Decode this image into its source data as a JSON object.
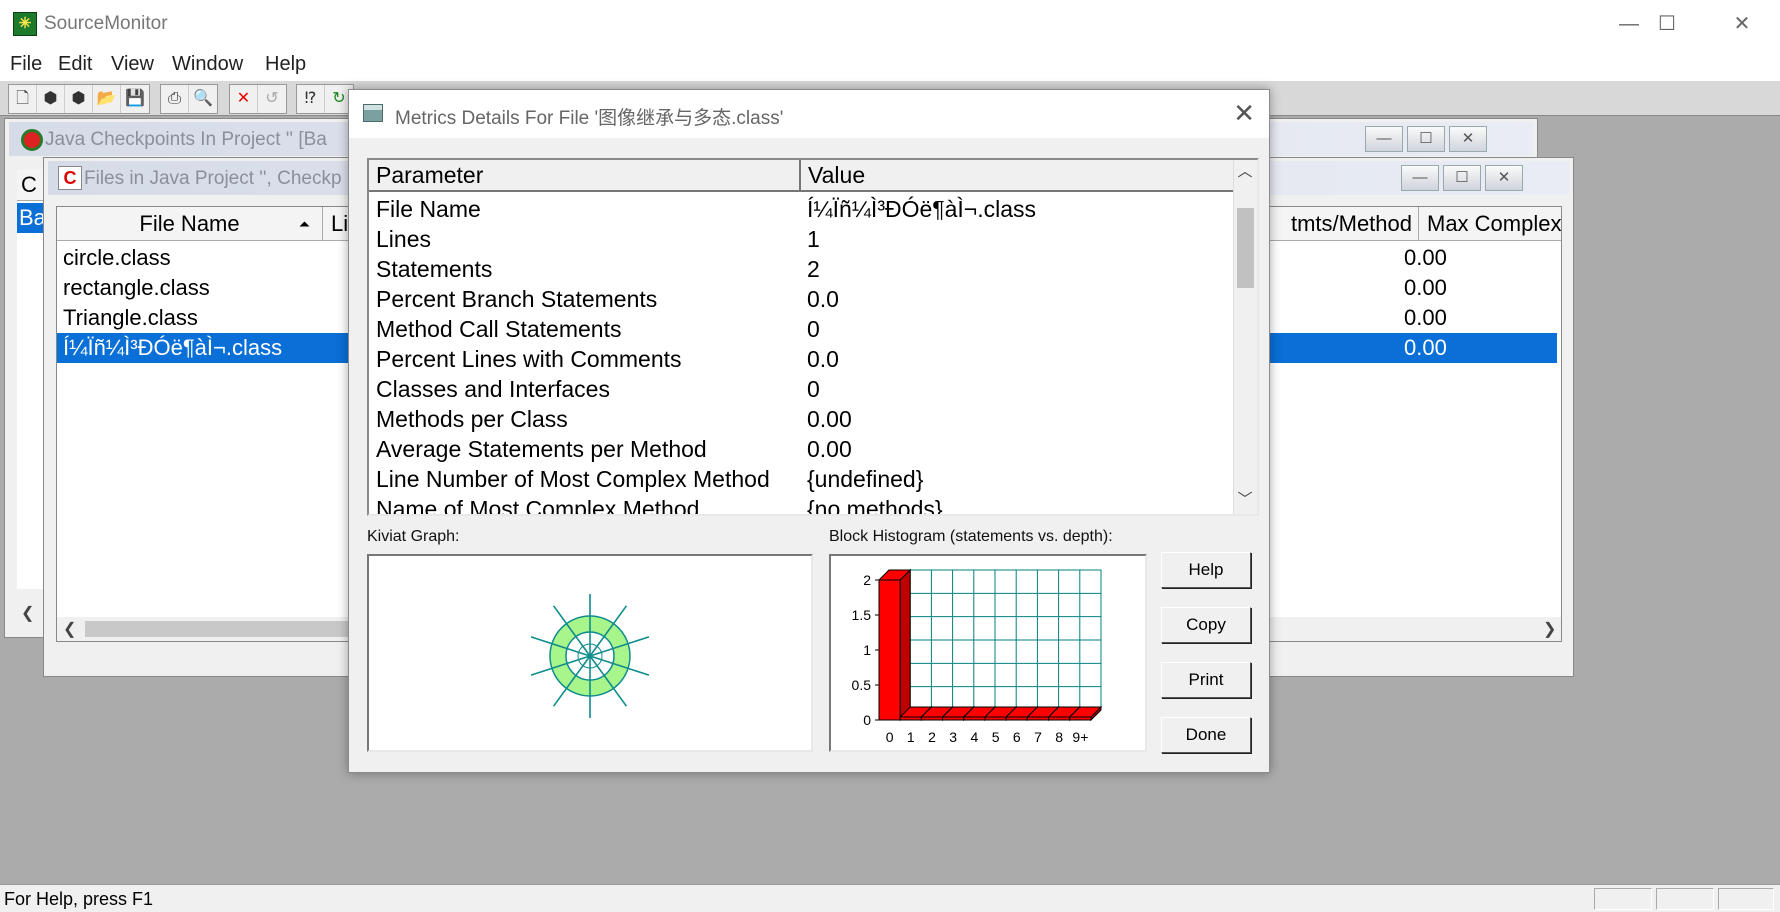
{
  "app": {
    "title": "SourceMonitor"
  },
  "window_controls": {
    "minimize": "—",
    "maximize": "☐",
    "close": "✕"
  },
  "menu": [
    "File",
    "Edit",
    "View",
    "Window",
    "Help"
  ],
  "checkpoints_window": {
    "title": "Java Checkpoints In Project ''  [Ba",
    "tab_label": "C",
    "selected_label": "Ba"
  },
  "files_window": {
    "title": "Files in Java Project '', Checkp",
    "columns": [
      "File Name",
      "Li",
      "tmts/Method",
      "Max Complex"
    ],
    "rows": [
      {
        "name": "circle.class",
        "value": "0.00"
      },
      {
        "name": "rectangle.class",
        "value": "0.00"
      },
      {
        "name": "Triangle.class",
        "value": "0.00"
      },
      {
        "name": "Í¼Ïñ¼Ì³ÐÓë¶àÌ¬.class",
        "value": "0.00",
        "selected": true
      }
    ]
  },
  "dialog": {
    "title": "Metrics Details For File '图像继承与多态.class'",
    "columns": [
      "Parameter",
      "Value"
    ],
    "rows": [
      {
        "param": "File Name",
        "value": "Í¼Ïñ¼Ì³ÐÓë¶àÌ¬.class"
      },
      {
        "param": "Lines",
        "value": "1"
      },
      {
        "param": "Statements",
        "value": "2"
      },
      {
        "param": "Percent Branch Statements",
        "value": "0.0"
      },
      {
        "param": "Method Call Statements",
        "value": "0"
      },
      {
        "param": "Percent Lines with Comments",
        "value": "0.0"
      },
      {
        "param": "Classes and Interfaces",
        "value": "0"
      },
      {
        "param": "Methods per Class",
        "value": "0.00"
      },
      {
        "param": "Average Statements per Method",
        "value": "0.00"
      },
      {
        "param": "Line Number of Most Complex Method",
        "value": "{undefined}"
      },
      {
        "param": "Name of Most Complex Method",
        "value": "{no methods}"
      }
    ],
    "kiviat_label": "Kiviat Graph:",
    "histogram_label": "Block Histogram (statements vs. depth):",
    "buttons": [
      "Help",
      "Copy",
      "Print",
      "Done"
    ]
  },
  "chart_data": {
    "type": "bar",
    "title": "Block Histogram (statements vs. depth):",
    "categories": [
      "0",
      "1",
      "2",
      "3",
      "4",
      "5",
      "6",
      "7",
      "8",
      "9+"
    ],
    "values": [
      2,
      0,
      0,
      0,
      0,
      0,
      0,
      0,
      0,
      0
    ],
    "yticks": [
      "0",
      "0.5",
      "1",
      "1.5",
      "2"
    ],
    "ylim": [
      0,
      2
    ],
    "colors": {
      "bar": "#ff0000",
      "grid": "#008080"
    }
  },
  "kiviat": {
    "colors": {
      "fill": "#a8f58c",
      "stroke": "#0f8c8c"
    }
  },
  "status": {
    "text": "For Help, press F1"
  }
}
